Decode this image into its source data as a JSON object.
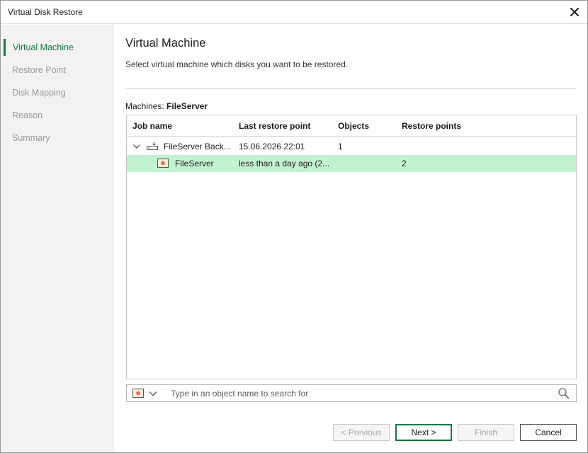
{
  "window": {
    "title": "Virtual Disk Restore"
  },
  "sidebar": {
    "items": [
      {
        "label": "Virtual Machine",
        "active": true
      },
      {
        "label": "Restore Point",
        "active": false
      },
      {
        "label": "Disk Mapping",
        "active": false
      },
      {
        "label": "Reason",
        "active": false
      },
      {
        "label": "Summary",
        "active": false
      }
    ]
  },
  "main": {
    "title": "Virtual Machine",
    "description": "Select virtual machine which disks you want to be restored.",
    "machines_label": "Machines:",
    "machines_value": "FileServer"
  },
  "table": {
    "columns": [
      "Job name",
      "Last restore point",
      "Objects",
      "Restore points"
    ],
    "rows": [
      {
        "icon": "backup-job-icon",
        "job_name": "FileServer Back...",
        "last_restore_point": "15.06.2026 22:01",
        "objects": "1",
        "restore_points": "",
        "expanded": true,
        "selected": false
      },
      {
        "icon": "vm-icon",
        "job_name": "FileServer",
        "last_restore_point": "less than a day ago (2...",
        "objects": "",
        "restore_points": "2",
        "expanded": false,
        "selected": true
      }
    ]
  },
  "search": {
    "placeholder": "Type in an object name to search for"
  },
  "buttons": {
    "previous": "< Previous",
    "next": "Next >",
    "finish": "Finish",
    "cancel": "Cancel"
  },
  "colors": {
    "accent": "#107c41",
    "selection": "#c3f2d1",
    "sidebar_bg": "#f2f2f2",
    "disabled_text": "#a8a8a8"
  }
}
